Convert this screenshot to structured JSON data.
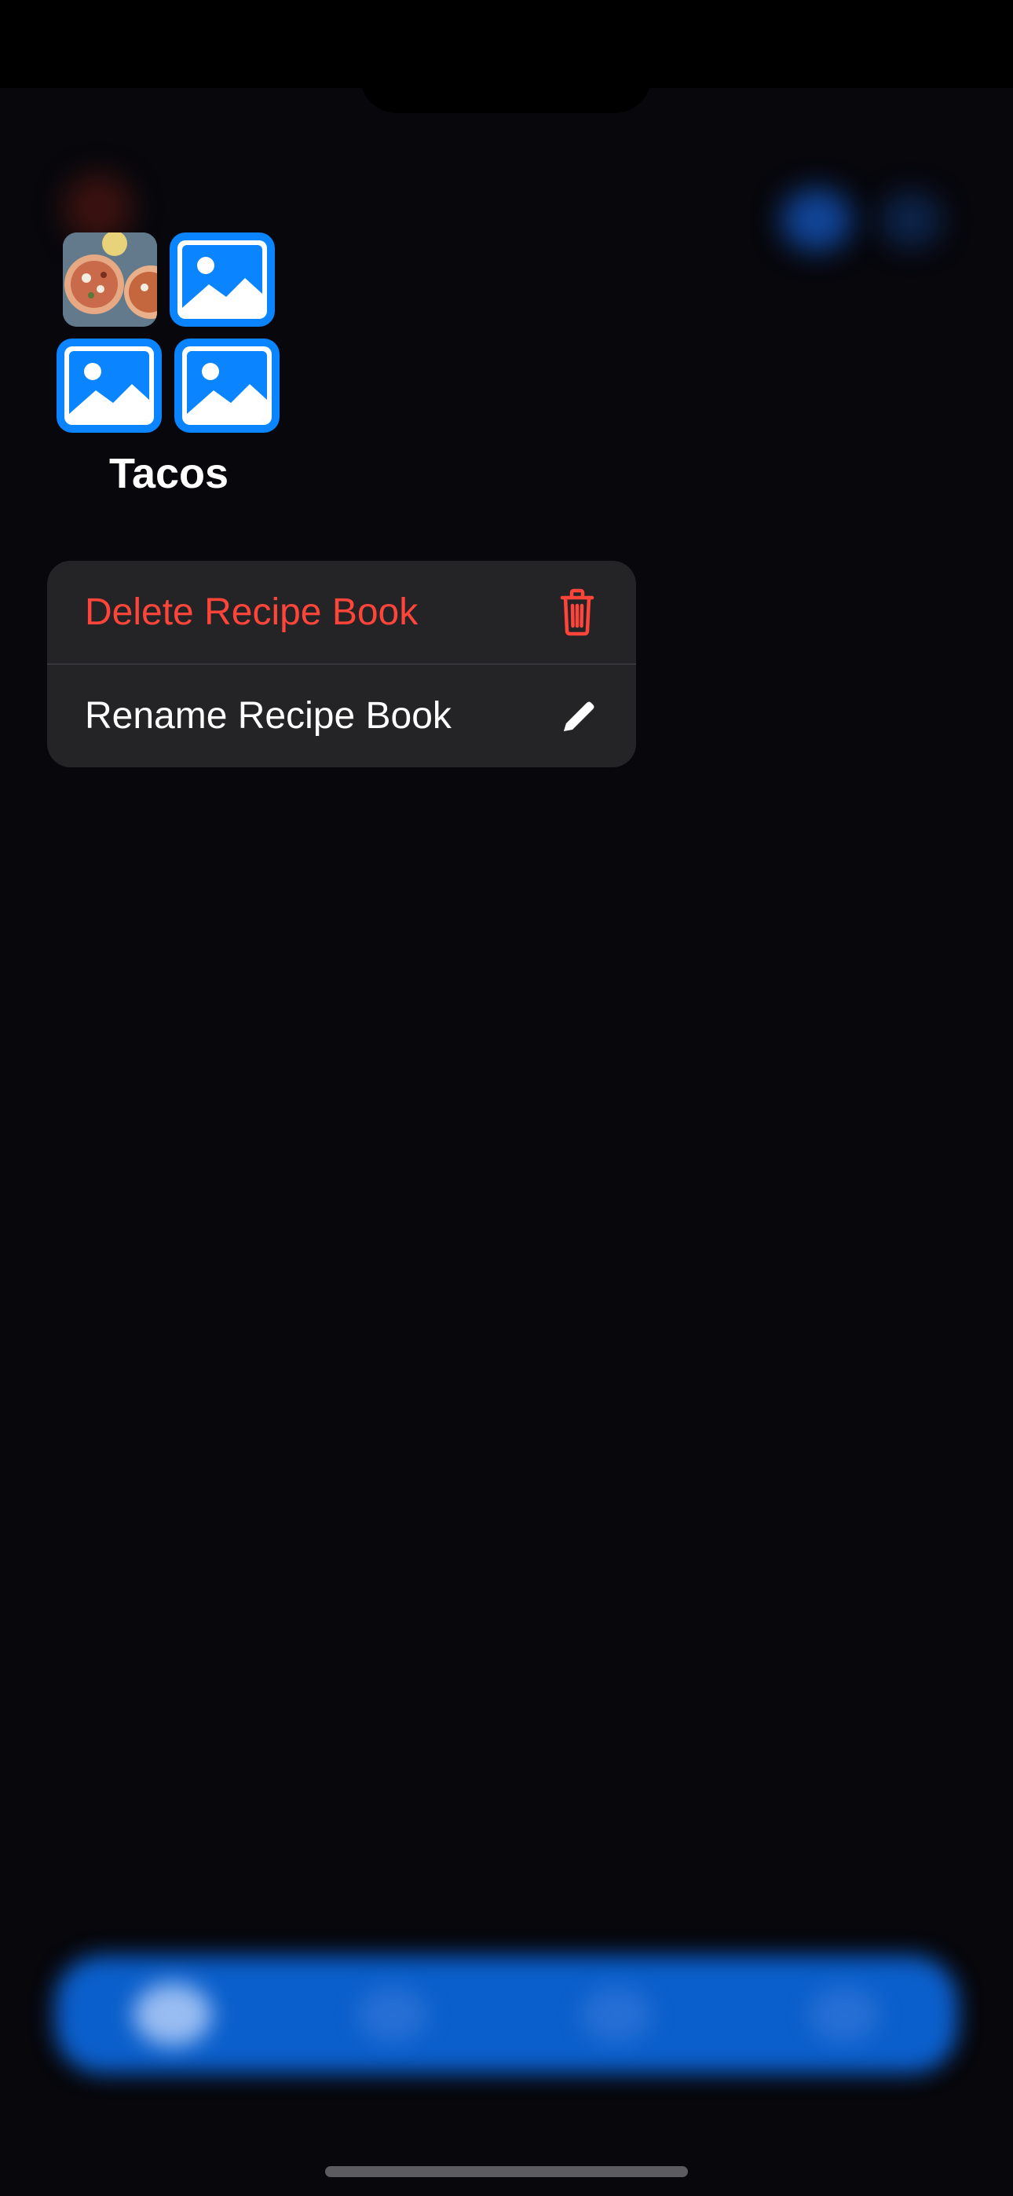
{
  "book": {
    "title": "Tacos"
  },
  "context_menu": {
    "items": [
      {
        "label": "Delete Recipe Book",
        "icon": "trash-icon",
        "style": "destructive",
        "color": "#ff453a"
      },
      {
        "label": "Rename Recipe Book",
        "icon": "pencil-icon",
        "style": "normal",
        "color": "#ffffff"
      }
    ]
  },
  "colors": {
    "accent": "#0a84ff",
    "destructive": "#ff453a",
    "menu_background": "#242426",
    "background": "#07070c"
  }
}
